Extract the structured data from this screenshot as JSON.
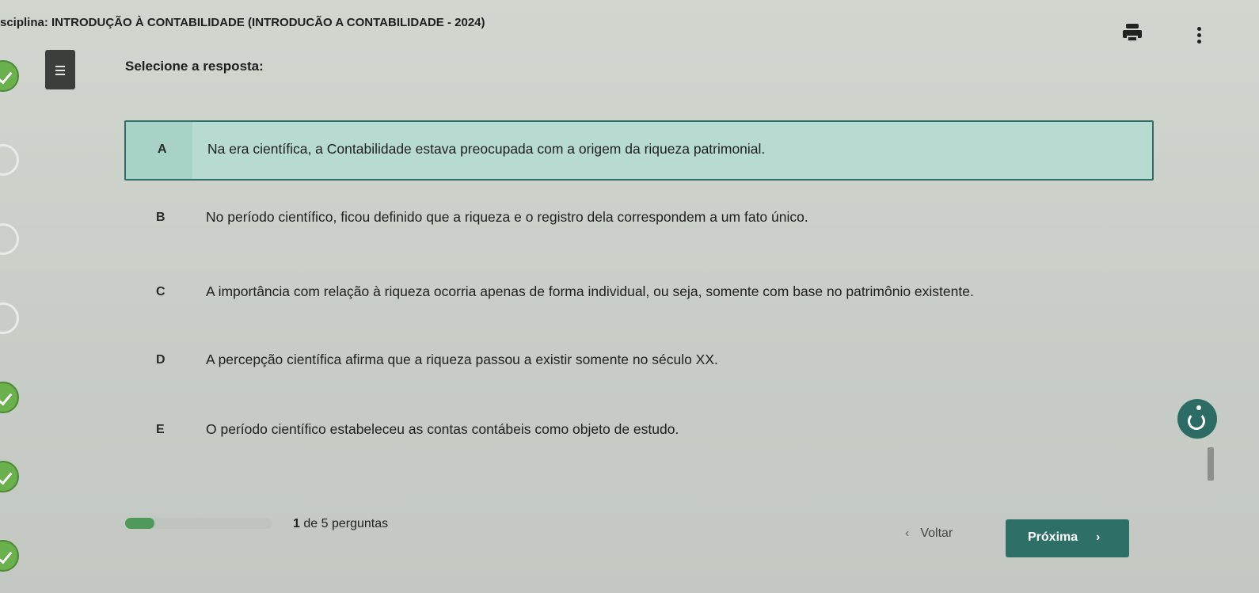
{
  "header": {
    "course_title": "sciplina: INTRODUÇÃO À CONTABILIDADE (INTRODUCÃO A CONTABILIDADE - 2024)",
    "print_icon": "printer-icon",
    "more_icon": "more-vertical-icon"
  },
  "menu_icon": "hamburger-menu-icon",
  "prompt": "Selecione a resposta:",
  "options": [
    {
      "letter": "A",
      "text": "Na era científica, a Contabilidade estava preocupada com a origem da riqueza patrimonial.",
      "selected": true
    },
    {
      "letter": "B",
      "text": "No período científico, ficou definido que a riqueza e o registro dela correspondem a um fato único.",
      "selected": false
    },
    {
      "letter": "C",
      "text": "A importância com relação à riqueza ocorria apenas de forma individual, ou seja, somente com base no patrimônio existente.",
      "selected": false
    },
    {
      "letter": "D",
      "text": "A percepção científica afirma que a riqueza passou a existir somente no século XX.",
      "selected": false
    },
    {
      "letter": "E",
      "text": "O período científico estabeleceu as contas contábeis como objeto de estudo.",
      "selected": false
    }
  ],
  "progress": {
    "current": "1",
    "suffix": " de 5 perguntas",
    "fraction": 0.2
  },
  "nav": {
    "back_chevron": "‹",
    "back_label": "Voltar",
    "next_label": "Próxima",
    "next_chevron": "›"
  },
  "colors": {
    "accent": "#2e6f67",
    "selected_bg": "#b7dbd1",
    "check_green": "#6ab04c"
  }
}
